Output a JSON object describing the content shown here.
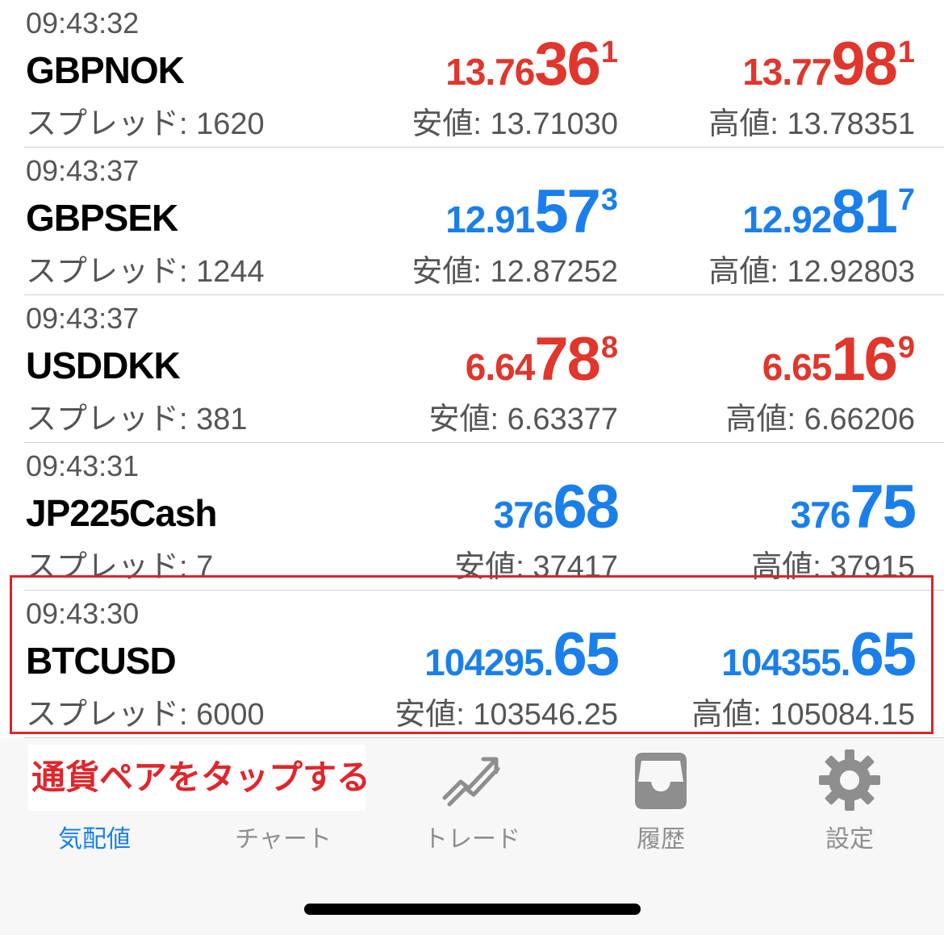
{
  "quotes": [
    {
      "time": "09:43:32",
      "symbol": "GBPNOK",
      "spread": "スプレッド: 1620",
      "bid": {
        "pre": "13.76",
        "big": "36",
        "sup": "1",
        "color": "red"
      },
      "ask": {
        "pre": "13.77",
        "big": "98",
        "sup": "1",
        "color": "red"
      },
      "low": "安値: 13.71030",
      "high": "高値: 13.78351"
    },
    {
      "time": "09:43:37",
      "symbol": "GBPSEK",
      "spread": "スプレッド: 1244",
      "bid": {
        "pre": "12.91",
        "big": "57",
        "sup": "3",
        "color": "blue"
      },
      "ask": {
        "pre": "12.92",
        "big": "81",
        "sup": "7",
        "color": "blue"
      },
      "low": "安値: 12.87252",
      "high": "高値: 12.92803"
    },
    {
      "time": "09:43:37",
      "symbol": "USDDKK",
      "spread": "スプレッド: 381",
      "bid": {
        "pre": "6.64",
        "big": "78",
        "sup": "8",
        "color": "red"
      },
      "ask": {
        "pre": "6.65",
        "big": "16",
        "sup": "9",
        "color": "red"
      },
      "low": "安値: 6.63377",
      "high": "高値: 6.66206"
    },
    {
      "time": "09:43:31",
      "symbol": "JP225Cash",
      "spread": "スプレッド: 7",
      "bid": {
        "pre": "376",
        "big": "68",
        "sup": "",
        "color": "blue"
      },
      "ask": {
        "pre": "376",
        "big": "75",
        "sup": "",
        "color": "blue"
      },
      "low": "安値: 37417",
      "high": "高値: 37915"
    },
    {
      "time": "09:43:30",
      "symbol": "BTCUSD",
      "spread": "スプレッド: 6000",
      "bid": {
        "pre": "104295.",
        "big": "65",
        "sup": "",
        "color": "blue"
      },
      "ask": {
        "pre": "104355.",
        "big": "65",
        "sup": "",
        "color": "blue"
      },
      "low": "安値: 103546.25",
      "high": "高値: 105084.15"
    }
  ],
  "annotation": "通貨ペアをタップする",
  "tabs": [
    {
      "label": "気配値",
      "icon": "quotes-icon",
      "active": true
    },
    {
      "label": "チャート",
      "icon": "chart-icon",
      "active": false
    },
    {
      "label": "トレード",
      "icon": "trade-icon",
      "active": false
    },
    {
      "label": "履歴",
      "icon": "history-inbox-icon",
      "active": false
    },
    {
      "label": "設定",
      "icon": "gear-icon",
      "active": false
    }
  ],
  "colors": {
    "up_red": "#e0362c",
    "down_blue": "#1a7fea",
    "highlight": "#d9262c",
    "tab_inactive": "#8e8e8e",
    "tab_active": "#1a7fea"
  }
}
